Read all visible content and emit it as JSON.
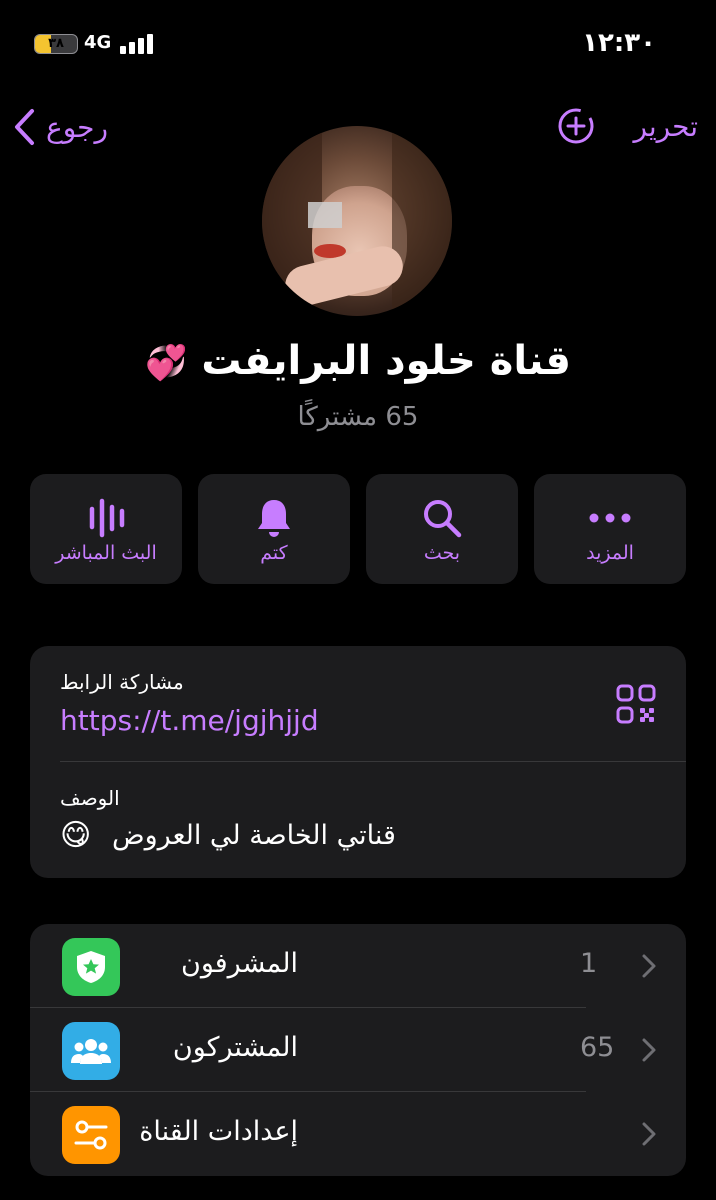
{
  "status_bar": {
    "battery": "٣٨",
    "network": "4G",
    "time": "١٢:٣٠",
    "battery_level": 0.38
  },
  "nav": {
    "back_label": "رجوع",
    "edit_label": "تحرير"
  },
  "channel": {
    "title": "قناة خلود البرايفت",
    "title_emoji": "💞",
    "subscribers": "65 مشتركًا"
  },
  "actions": [
    {
      "label": "المزيد",
      "icon": "more-icon"
    },
    {
      "label": "بحث",
      "icon": "search-icon"
    },
    {
      "label": "كتم",
      "icon": "bell-icon"
    },
    {
      "label": "البث المباشر",
      "icon": "live-stream-icon"
    }
  ],
  "info": {
    "link_label": "مشاركة الرابط",
    "link_value": "https://t.me/jgjhjjd",
    "description_label": "الوصف",
    "description_value": "قناتي الخاصة لي العروض",
    "description_emoji": "😋"
  },
  "list": [
    {
      "label": "المشرفون",
      "count": "1",
      "icon": "admin-badge-icon",
      "color": "#34c759"
    },
    {
      "label": "المشتركون",
      "count": "65",
      "icon": "subscribers-icon",
      "color": "#32ade6"
    },
    {
      "label": "إعدادات القناة",
      "count": "",
      "icon": "channel-settings-icon",
      "color": "#ff9500"
    }
  ],
  "colors": {
    "accent": "#c77dff",
    "background": "#000000",
    "card": "#1c1c1e"
  }
}
